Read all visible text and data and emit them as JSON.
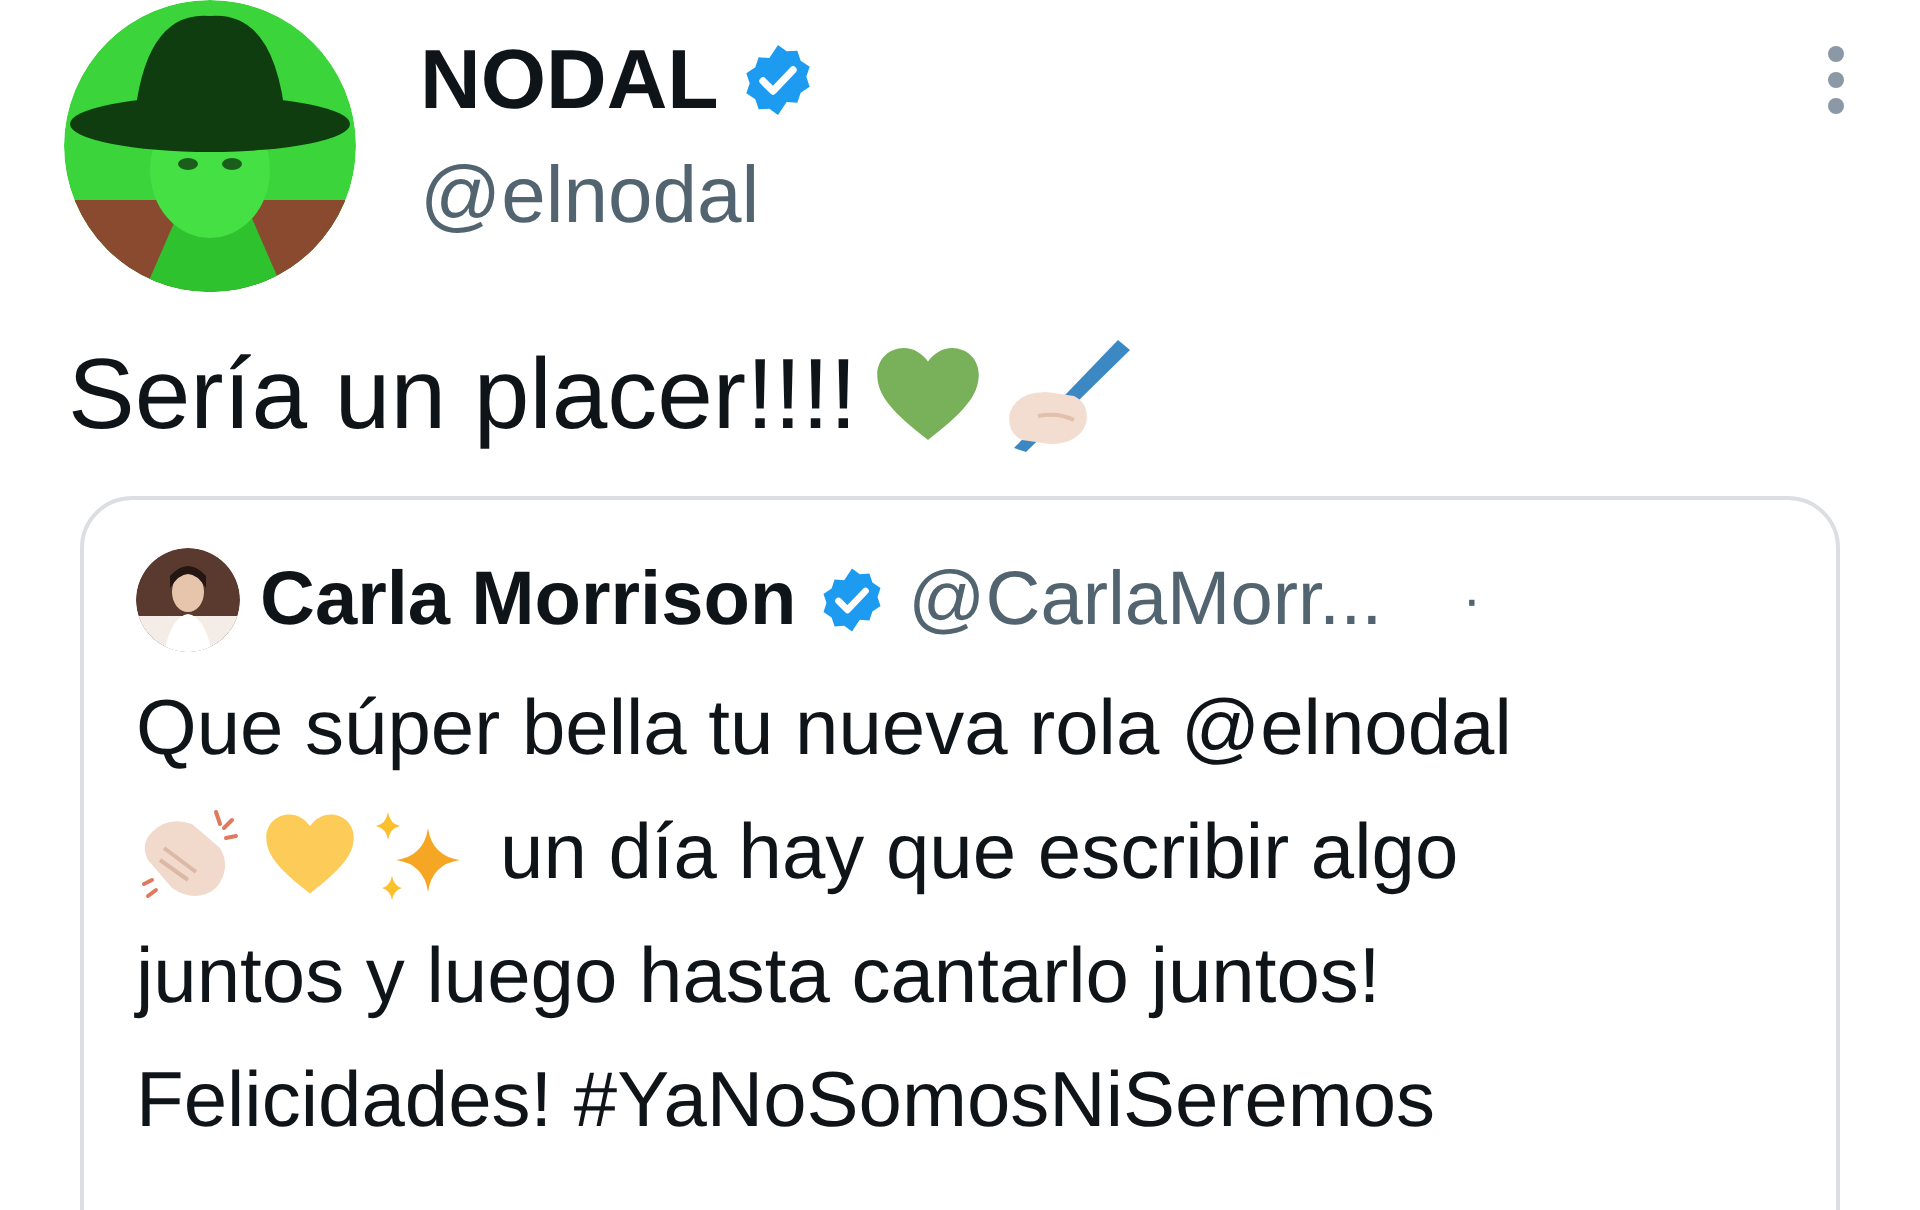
{
  "author": {
    "name": "NODAL",
    "verified": true,
    "handle": "@elnodal"
  },
  "tweet": {
    "text": "Sería un placer!!!!"
  },
  "quote": {
    "author": {
      "name": "Carla Morrison",
      "verified": true,
      "handle": "@CarlaMorr...",
      "separator": "·"
    },
    "lines": [
      "Que súper bella tu nueva rola @elnodal",
      "un día hay que escribir algo",
      "juntos y luego hasta cantarlo juntos!",
      "Felicidades! #YaNoSomosNiSeremos"
    ]
  }
}
